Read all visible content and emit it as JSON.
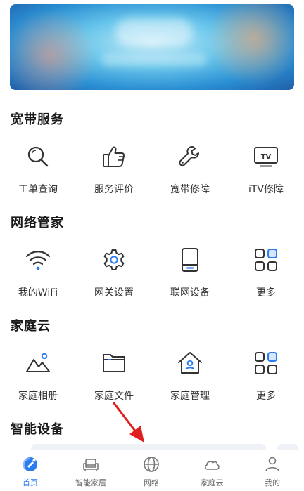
{
  "sections": [
    {
      "title": "宽带服务",
      "items": [
        {
          "label": "工单查询",
          "icon": "search-icon"
        },
        {
          "label": "服务评价",
          "icon": "thumbs-up-icon"
        },
        {
          "label": "宽带修障",
          "icon": "wrench-icon"
        },
        {
          "label": "iTV修障",
          "icon": "tv-icon"
        }
      ]
    },
    {
      "title": "网络管家",
      "items": [
        {
          "label": "我的WiFi",
          "icon": "wifi-icon"
        },
        {
          "label": "网关设置",
          "icon": "gear-icon"
        },
        {
          "label": "联网设备",
          "icon": "device-icon"
        },
        {
          "label": "更多",
          "icon": "grid-more-icon"
        }
      ]
    },
    {
      "title": "家庭云",
      "items": [
        {
          "label": "家庭相册",
          "icon": "photo-album-icon"
        },
        {
          "label": "家庭文件",
          "icon": "folder-icon"
        },
        {
          "label": "家庭管理",
          "icon": "home-manage-icon"
        },
        {
          "label": "更多",
          "icon": "grid-more-icon"
        }
      ]
    },
    {
      "title": "智能设备",
      "items": []
    }
  ],
  "tabbar": [
    {
      "label": "首页",
      "icon": "home-satellite-icon",
      "active": true
    },
    {
      "label": "智能家居",
      "icon": "sofa-icon",
      "active": false
    },
    {
      "label": "网络",
      "icon": "globe-icon",
      "active": false
    },
    {
      "label": "家庭云",
      "icon": "cloud-icon",
      "active": false
    },
    {
      "label": "我的",
      "icon": "person-icon",
      "active": false
    }
  ],
  "colors": {
    "icon_stroke": "#333333",
    "accent": "#2b7cf0",
    "accent_light": "#8fb8f6",
    "annotation_arrow": "#e02020"
  }
}
